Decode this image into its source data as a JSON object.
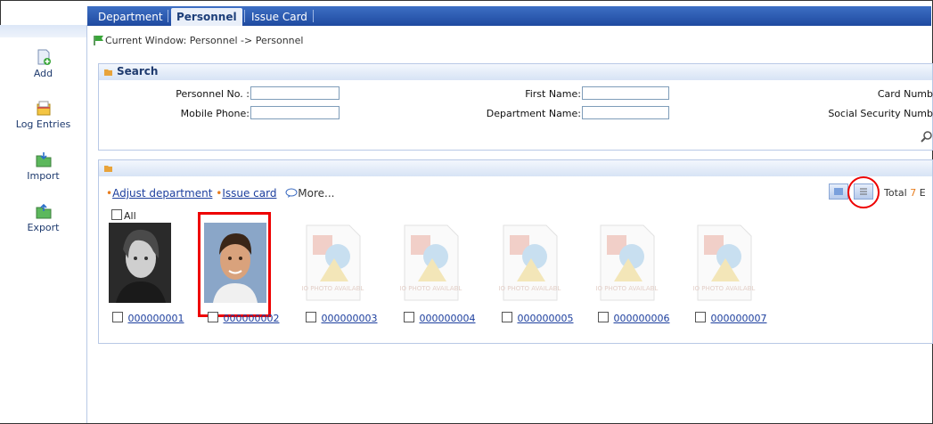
{
  "tabs": [
    {
      "label": "Department"
    },
    {
      "label": "Personnel"
    },
    {
      "label": "Issue Card"
    }
  ],
  "sidebar": {
    "items": [
      {
        "label": "Add",
        "icon": "add-document-icon"
      },
      {
        "label": "Log Entries",
        "icon": "log-entries-icon"
      },
      {
        "label": "Import",
        "icon": "import-folder-icon"
      },
      {
        "label": "Export",
        "icon": "export-folder-icon"
      }
    ]
  },
  "breadcrumb": "Current Window: Personnel -> Personnel",
  "search": {
    "title": "Search",
    "personnel_no_label": "Personnel No. :",
    "mobile_phone_label": "Mobile Phone:",
    "first_name_label": "First Name:",
    "department_name_label": "Department Name:",
    "card_number_label": "Card Numb",
    "ssn_label": "Social Security Numb"
  },
  "list": {
    "adjust_department": "Adjust department",
    "issue_card": "Issue card",
    "more": "More...",
    "total_prefix": "Total",
    "total_count": "7",
    "total_suffix": "E",
    "all_label": "All",
    "people": [
      {
        "id": "000000001",
        "photo": "grayscale-portrait"
      },
      {
        "id": "000000002",
        "photo": "color-portrait"
      },
      {
        "id": "000000003",
        "photo": "no-photo"
      },
      {
        "id": "000000004",
        "photo": "no-photo"
      },
      {
        "id": "000000005",
        "photo": "no-photo"
      },
      {
        "id": "000000006",
        "photo": "no-photo"
      },
      {
        "id": "000000007",
        "photo": "no-photo"
      }
    ],
    "no_photo_text": "NO PHOTO AVAILABLE"
  },
  "colors": {
    "accent": "#1f4aa0",
    "link": "#1d3f9e",
    "highlight": "#e00000",
    "orange": "#e87d1e"
  }
}
